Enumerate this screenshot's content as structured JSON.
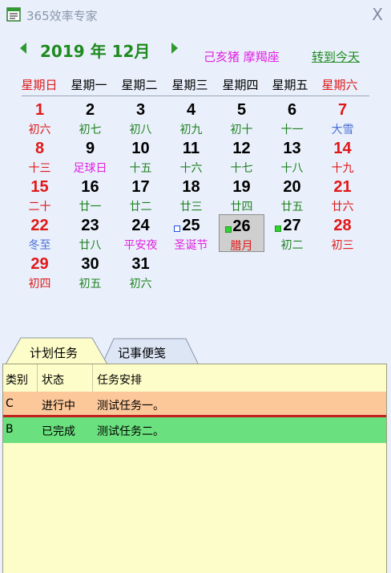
{
  "app": {
    "title": "365效率专家",
    "close_label": "X"
  },
  "nav": {
    "year_month": "2019 年 12月",
    "ganzhi": "己亥猪",
    "zodiac": "摩羯座",
    "today_link": "转到今天"
  },
  "week_days": [
    "星期日",
    "星期一",
    "星期二",
    "星期三",
    "星期四",
    "星期五",
    "星期六"
  ],
  "calendar": [
    {
      "day": "1",
      "lunar": "初六"
    },
    {
      "day": "2",
      "lunar": "初七"
    },
    {
      "day": "3",
      "lunar": "初八"
    },
    {
      "day": "4",
      "lunar": "初九"
    },
    {
      "day": "5",
      "lunar": "初十"
    },
    {
      "day": "6",
      "lunar": "十一"
    },
    {
      "day": "7",
      "lunar": "大雪"
    },
    {
      "day": "8",
      "lunar": "十三"
    },
    {
      "day": "9",
      "lunar": "足球日"
    },
    {
      "day": "10",
      "lunar": "十五"
    },
    {
      "day": "11",
      "lunar": "十六"
    },
    {
      "day": "12",
      "lunar": "十七"
    },
    {
      "day": "13",
      "lunar": "十八"
    },
    {
      "day": "14",
      "lunar": "十九"
    },
    {
      "day": "15",
      "lunar": "二十"
    },
    {
      "day": "16",
      "lunar": "廿一"
    },
    {
      "day": "17",
      "lunar": "廿二"
    },
    {
      "day": "18",
      "lunar": "廿三"
    },
    {
      "day": "19",
      "lunar": "廿四"
    },
    {
      "day": "20",
      "lunar": "廿五"
    },
    {
      "day": "21",
      "lunar": "廿六"
    },
    {
      "day": "22",
      "lunar": "冬至"
    },
    {
      "day": "23",
      "lunar": "廿八"
    },
    {
      "day": "24",
      "lunar": "平安夜"
    },
    {
      "day": "25",
      "lunar": "圣诞节"
    },
    {
      "day": "26",
      "lunar": "腊月"
    },
    {
      "day": "27",
      "lunar": "初二"
    },
    {
      "day": "28",
      "lunar": "初三"
    },
    {
      "day": "29",
      "lunar": "初四"
    },
    {
      "day": "30",
      "lunar": "初五"
    },
    {
      "day": "31",
      "lunar": "初六"
    }
  ],
  "tabs": [
    "计划任务",
    "记事便笺"
  ],
  "task_table": {
    "headers": [
      "类别",
      "状态",
      "任务安排"
    ],
    "rows": [
      [
        "C",
        "进行中",
        "测试任务一。"
      ],
      [
        "B",
        "已完成",
        "测试任务二。"
      ]
    ]
  },
  "colors": {
    "background": "#e9f0fb",
    "accent_green": "#1f8a1f",
    "weekend_red": "#e01818",
    "holiday_magenta": "#e020e0",
    "solar_term_blue": "#4a6ed8",
    "selected_cell": "#cfcfcf",
    "row_in_progress": "#fcc89a",
    "row_done": "#6be07e",
    "panel_bg": "#fdfdc9"
  }
}
